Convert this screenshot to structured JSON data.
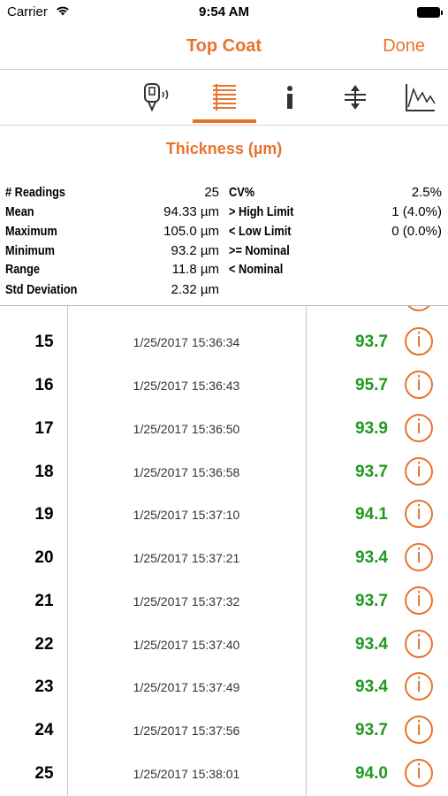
{
  "status_bar": {
    "carrier": "Carrier",
    "time": "9:54 AM"
  },
  "nav": {
    "title": "Top Coat",
    "done_label": "Done"
  },
  "toolbar": {
    "tabs": [
      {
        "icon": "probe-icon"
      },
      {
        "icon": "list-icon",
        "active": true
      },
      {
        "icon": "info-icon"
      },
      {
        "icon": "limits-icon"
      },
      {
        "icon": "chart-icon"
      }
    ]
  },
  "section": {
    "title": "Thickness (µm)"
  },
  "stats": {
    "left": [
      {
        "label": "# Readings",
        "value": "25"
      },
      {
        "label": "Mean",
        "value": "94.33 µm"
      },
      {
        "label": "Maximum",
        "value": "105.0 µm"
      },
      {
        "label": "Minimum",
        "value": "93.2 µm"
      },
      {
        "label": "Range",
        "value": "11.8 µm"
      },
      {
        "label": "Std Deviation",
        "value": "2.32 µm"
      }
    ],
    "right": [
      {
        "label": "CV%",
        "value": "2.5%"
      },
      {
        "label": "> High Limit",
        "value": "1 (4.0%)"
      },
      {
        "label": "< Low Limit",
        "value": "0 (0.0%)"
      },
      {
        "label": ">= Nominal",
        "value": ""
      },
      {
        "label": "< Nominal",
        "value": ""
      }
    ]
  },
  "readings": [
    {
      "num": "15",
      "timestamp": "1/25/2017 15:36:34",
      "value": "93.7",
      "info": "i"
    },
    {
      "num": "16",
      "timestamp": "1/25/2017 15:36:43",
      "value": "95.7",
      "info": "i"
    },
    {
      "num": "17",
      "timestamp": "1/25/2017 15:36:50",
      "value": "93.9",
      "info": "i"
    },
    {
      "num": "18",
      "timestamp": "1/25/2017 15:36:58",
      "value": "93.7",
      "info": "i"
    },
    {
      "num": "19",
      "timestamp": "1/25/2017 15:37:10",
      "value": "94.1",
      "info": "i"
    },
    {
      "num": "20",
      "timestamp": "1/25/2017 15:37:21",
      "value": "93.4",
      "info": "i"
    },
    {
      "num": "21",
      "timestamp": "1/25/2017 15:37:32",
      "value": "93.7",
      "info": "i"
    },
    {
      "num": "22",
      "timestamp": "1/25/2017 15:37:40",
      "value": "93.4",
      "info": "i"
    },
    {
      "num": "23",
      "timestamp": "1/25/2017 15:37:49",
      "value": "93.4",
      "info": "i"
    },
    {
      "num": "24",
      "timestamp": "1/25/2017 15:37:56",
      "value": "93.7",
      "info": "i"
    },
    {
      "num": "25",
      "timestamp": "1/25/2017 15:38:01",
      "value": "94.0",
      "info": "i"
    }
  ],
  "colors": {
    "accent": "#e8732c",
    "value_green": "#1e9a1e"
  }
}
